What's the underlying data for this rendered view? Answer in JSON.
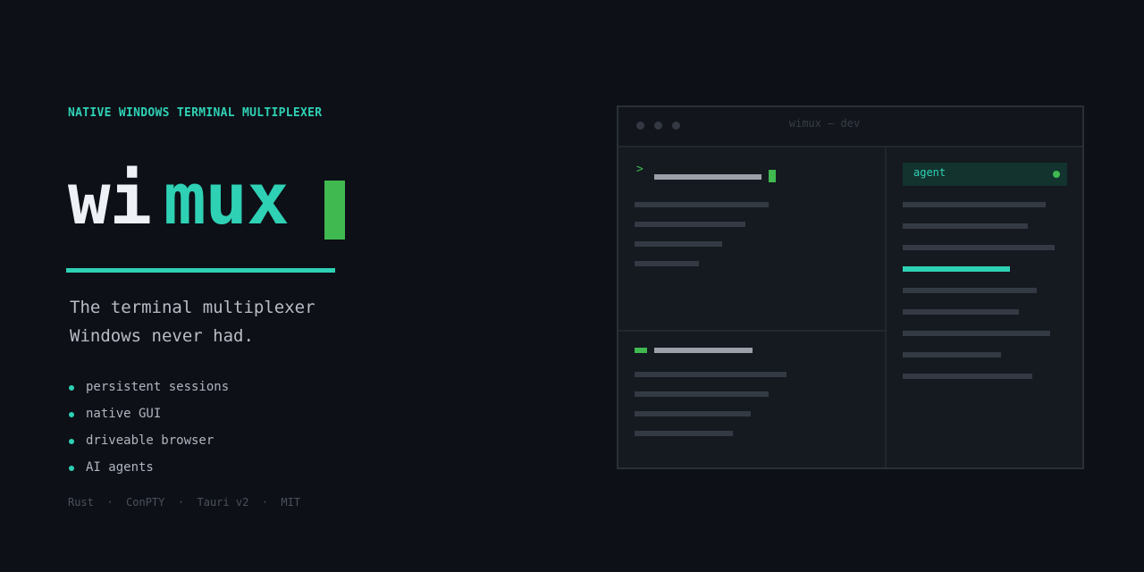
{
  "hero": {
    "eyebrow": "NATIVE WINDOWS TERMINAL MULTIPLEXER",
    "logo_part1": "wi",
    "logo_part2": "mux",
    "tagline_line1": "The terminal multiplexer",
    "tagline_line2": "Windows never had.",
    "features": [
      "persistent sessions",
      "native GUI",
      "driveable browser",
      "AI agents"
    ],
    "stack": "Rust  ·  ConPTY  ·  Tauri v2  ·  MIT"
  },
  "window": {
    "title": "wimux — dev",
    "prompt_symbol": ">",
    "agent_tab_label": "agent"
  },
  "colors": {
    "background": "#0d1017",
    "accent_teal": "#2fd1b5",
    "accent_green": "#3fb950",
    "text_primary": "#eef1f6",
    "text_muted": "#b0b5bf"
  }
}
